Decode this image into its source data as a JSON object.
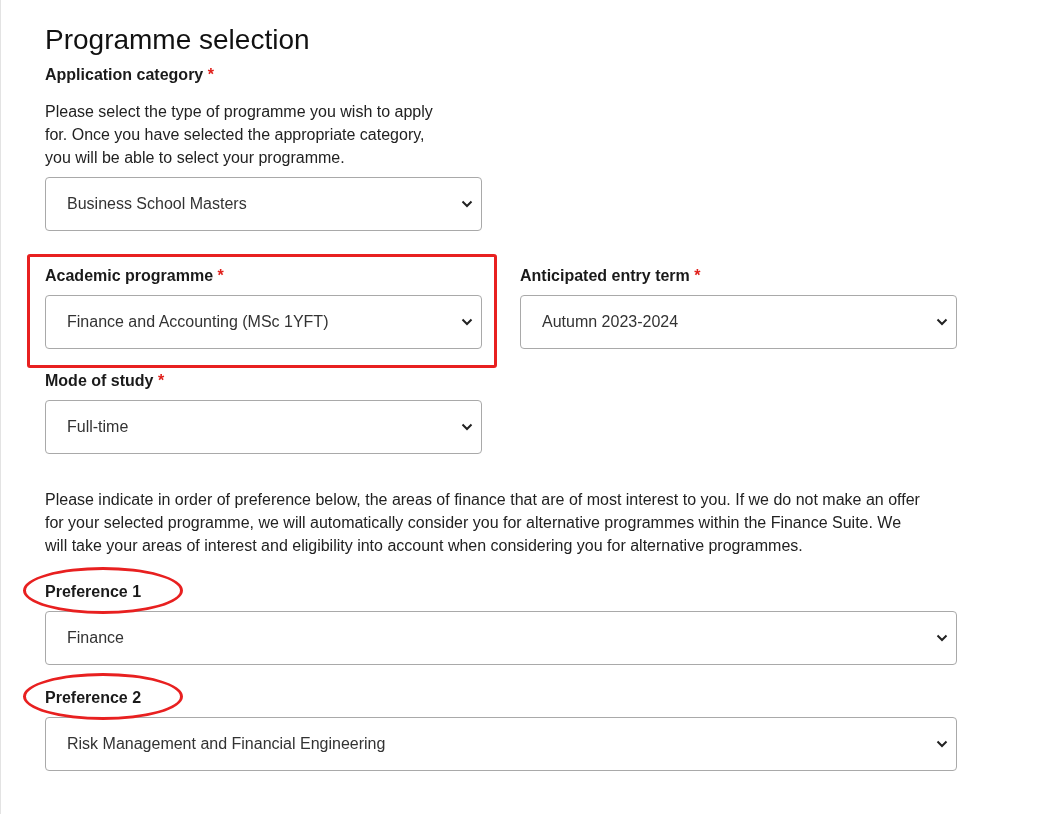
{
  "heading": "Programme selection",
  "category": {
    "label": "Application category",
    "required_mark": "*",
    "help": "Please select the type of programme you wish to apply for. Once you have selected the appropriate category, you will be able to select your programme.",
    "value": "Business School Masters",
    "boxed": false
  },
  "row": [
    {
      "label": "Academic programme",
      "required_mark": "*",
      "value": "Finance and Accounting (MSc 1YFT)",
      "boxed": true
    },
    {
      "label": "Anticipated entry term",
      "required_mark": "*",
      "value": "Autumn 2023-2024",
      "boxed": false
    }
  ],
  "mode": {
    "label": "Mode of study",
    "required_mark": "*",
    "value": "Full-time",
    "boxed": false
  },
  "preferences_intro": "Please indicate in order of preference below, the areas of finance that are of most interest to you. If we do not make an offer for your selected programme, we will automatically consider you for alternative programmes within the Finance Suite. We will take your areas of interest and eligibility into account when considering you for alternative programmes.",
  "preferences": [
    {
      "label": "Preference 1",
      "value": "Finance",
      "circled": true
    },
    {
      "label": "Preference 2",
      "value": "Risk Management and Financial Engineering",
      "circled": true
    }
  ]
}
